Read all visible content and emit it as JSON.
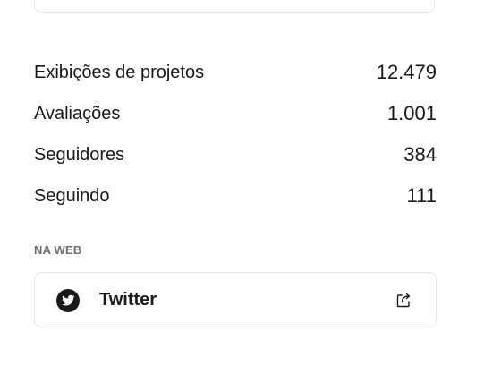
{
  "stats": [
    {
      "label": "Exibições de projetos",
      "value": "12.479"
    },
    {
      "label": "Avaliações",
      "value": "1.001"
    },
    {
      "label": "Seguidores",
      "value": "384"
    },
    {
      "label": "Seguindo",
      "value": "111"
    }
  ],
  "web_section": {
    "title": "NA WEB",
    "links": [
      {
        "label": "Twitter",
        "icon": "twitter-icon",
        "action_icon": "external-link-icon"
      }
    ]
  },
  "colors": {
    "text": "#191919",
    "muted": "#6e6e6e",
    "border": "#e6e6e6"
  }
}
